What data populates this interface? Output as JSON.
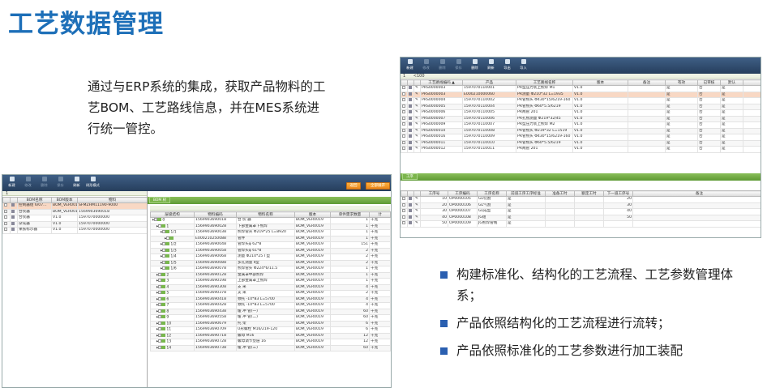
{
  "title": "工艺数据管理",
  "intro": "通过与ERP系统的集成，获取产品物料的工艺BOM、工艺路线信息，并在MES系统进行统一管控。",
  "bullets": [
    "构建标准化、结构化的工艺流程、工艺参数管理体系；",
    "产品依照结构化的工艺流程进行流转；",
    "产品依照标准化的工艺参数进行加工装配"
  ],
  "left": {
    "toolbar": [
      "新建",
      "修改",
      "删除",
      "保存",
      "刷新",
      "树形模式"
    ],
    "page": "1",
    "headers": [
      "BOM名称",
      "BOM版本",
      "物料"
    ],
    "rows": [
      [
        "控制器组 6/07...",
        "BOM_VER0012",
        "SFMZHM11190-9000"
      ],
      [
        "合伙器",
        "BOM_VER0019",
        "1569903690018"
      ],
      [
        "合伙器",
        "V1.0",
        "1597070000000"
      ],
      [
        "杂光器",
        "V1.0",
        "1597070000000"
      ],
      [
        "果核标示器",
        "V1.0",
        "1597070000000"
      ]
    ],
    "btn_a": "返回",
    "btn_b": "全部展开",
    "tab": "BOM 树",
    "tree_headers": [
      "层级结构",
      "物料编码",
      "物料名称",
      "版本",
      "单件需求数量",
      "计"
    ],
    "tree": [
      [
        "0",
        "1569903690018",
        "合 伙 器",
        "BOM_VER0019",
        "1",
        "千克"
      ],
      [
        "1",
        "1569903690028",
        "下部金属罩下熊焊",
        "BOM_VER0019",
        "1",
        "千克"
      ],
      [
        "1/1",
        "1569903690038",
        "熊焊管壳 Φ219*25 L=8920",
        "BOM_VER0019",
        "1",
        "千克"
      ],
      [
        "",
        "E000210250088",
        "管件",
        "BOM_VER0019",
        "1",
        "千克"
      ],
      [
        "1/2",
        "1569903690048",
        "管焊头φ 62*8",
        "BOM_VER0019",
        "151",
        "千克"
      ],
      [
        "1/3",
        "1569903690058",
        "管焊头φ 61*8",
        "BOM_VER0019",
        "2",
        "千克"
      ],
      [
        "1/4",
        "1569903690068",
        "测量 Φ210*25 I 型",
        "BOM_VER0019",
        "2",
        "千克"
      ],
      [
        "1/5",
        "1569903690088",
        "多孔测量 Ⅱ型",
        "BOM_VER0019",
        "2",
        "千克"
      ],
      [
        "1/6",
        "1569903690078",
        "熊焊管头 Φ224*6/11.5",
        "BOM_VER0019",
        "1",
        "千克"
      ],
      [
        "2",
        "1569903690128",
        "金属罩中部熊焊",
        "BOM_VER0019",
        "1",
        "千克"
      ],
      [
        "3",
        "1569903690198",
        "上部金属罩上熊焊",
        "BOM_VER0019",
        "1",
        "千克"
      ],
      [
        "4",
        "1569903690308",
        "支 采",
        "BOM_VER0019",
        "4",
        "千克"
      ],
      [
        "5",
        "1569903690378",
        "支 采",
        "BOM_VER0019",
        "2",
        "千克"
      ],
      [
        "6",
        "1569903690418",
        "颈托 -10*83 L=5700",
        "BOM_VER0019",
        "4",
        "千克"
      ],
      [
        "7",
        "1569903690428",
        "颈托 -10*83 L=5700",
        "BOM_VER0019",
        "4",
        "千克"
      ],
      [
        "8",
        "1569903690438",
        "缓 冲 管(一)",
        "BOM_VER0019",
        "60",
        "千克"
      ],
      [
        "9",
        "1569903690558",
        "缓 冲 管(二)",
        "BOM_VER0019",
        "60",
        "千克"
      ],
      [
        "10",
        "1569903690679",
        "托 架",
        "BOM_VER0019",
        "6",
        "千克"
      ],
      [
        "11",
        "1569903690709",
        "U形螺栓 M16/219-120",
        "BOM_VER0019",
        "6",
        "千克"
      ],
      [
        "12",
        "1569903690718",
        "螺母 M16",
        "BOM_VER0019",
        "12",
        "千克"
      ],
      [
        "13",
        "1569903690728",
        "螺母调节垫层 16",
        "BOM_VER0019",
        "12",
        "千克"
      ],
      [
        "14",
        "1569903690738",
        "缓 冲 管(三)",
        "BOM_VER0019",
        "60",
        "千克"
      ]
    ]
  },
  "right": {
    "toolbar": [
      "新建",
      "修改",
      "删除",
      "保存",
      "删除",
      "刷新",
      "导出",
      "导入"
    ],
    "page": "1",
    "page_size": "<100",
    "headers": [
      "工艺路线编码 ▲",
      "产品",
      "工艺路线名称",
      "版本",
      "备注",
      "有效",
      "已审核",
      "默认"
    ],
    "rows": [
      [
        "PRS0000003",
        "1597070110001",
        "PR型压力装上熊焊 M1",
        "V1.0",
        "",
        "是",
        "否",
        "是"
      ],
      [
        "PRS0000003",
        "E000210000060",
        "PR测量 Φ210*32 L=1935",
        "V1.0",
        "",
        "是",
        "否",
        "是"
      ],
      [
        "PRS0000004",
        "1597070110002",
        "PR管熊头 Φ430*15/6219-160",
        "V1.0",
        "",
        "是",
        "否",
        "是"
      ],
      [
        "PRS0000005",
        "1597070110004",
        "PR管熊头 Φ60*5.5/6219",
        "V1.0",
        "",
        "是",
        "否",
        "是"
      ],
      [
        "PRS0000006",
        "1597070110005",
        "PR两管 201",
        "V1.0",
        "",
        "是",
        "否",
        "是"
      ],
      [
        "PRS0000007",
        "1597070110006",
        "PR孔熊测量 Φ219*32/45",
        "V1.0",
        "",
        "是",
        "否",
        "是"
      ],
      [
        "PRS0000009",
        "1597070110007",
        "PR型压力装上熊焊 M2",
        "V1.0",
        "",
        "是",
        "否",
        "是"
      ],
      [
        "PRS0000010",
        "1597070110008",
        "PR管熊头 Φ219*32 L=1519",
        "V1.0",
        "",
        "是",
        "否",
        "是"
      ],
      [
        "PRS0000016",
        "1597070110009",
        "PR管熊头 Φ430*15/6219-160",
        "V1.0",
        "",
        "是",
        "否",
        "是"
      ],
      [
        "PRS0000011",
        "1597070110010",
        "PR管熊头 Φ60*5.5/6219",
        "V1.0",
        "",
        "是",
        "否",
        "是"
      ],
      [
        "PRS0000012",
        "1597070110011",
        "PR两管 201",
        "V1.0",
        "",
        "是",
        "否",
        "是"
      ]
    ],
    "tab": "工序",
    "op_headers": [
      "工序号",
      "工序编码",
      "工序名称",
      "前道工序工序标准",
      "准备工时",
      "额定工时",
      "下一道工序号",
      "备注"
    ],
    "ops": [
      [
        "10",
        "OP0000105",
        "GL切割",
        "是",
        "",
        "",
        "20",
        ""
      ],
      [
        "20",
        "OP0000106",
        "GL气割",
        "是",
        "",
        "",
        "30",
        ""
      ],
      [
        "30",
        "OP0000107",
        "GL成型",
        "是",
        "",
        "",
        "40",
        ""
      ],
      [
        "40",
        "OP0000108",
        "JG组",
        "是",
        "",
        "",
        "50",
        ""
      ],
      [
        "50",
        "OP0000109",
        "JG熊焊管线",
        "是",
        "",
        "",
        "",
        ""
      ]
    ]
  }
}
